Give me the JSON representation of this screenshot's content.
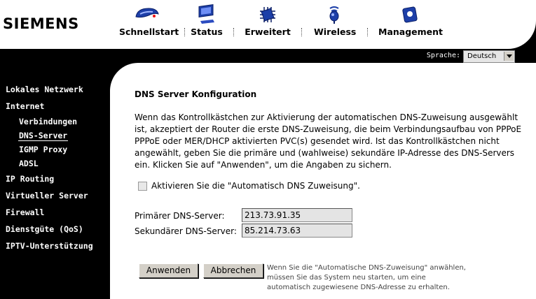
{
  "header": {
    "logo": "SIEMENS",
    "nav": [
      {
        "label": "Schnellstart",
        "icon": "setup-wand-icon"
      },
      {
        "label": "Status",
        "icon": "monitor-icon"
      },
      {
        "label": "Erweitert",
        "icon": "chip-icon"
      },
      {
        "label": "Wireless",
        "icon": "antenna-icon"
      },
      {
        "label": "Management",
        "icon": "card-icon"
      }
    ]
  },
  "language": {
    "label": "Sprache:",
    "selected": "Deutsch"
  },
  "sidebar": {
    "items": [
      {
        "label": "Lokales Netzwerk"
      },
      {
        "label": "Internet"
      },
      {
        "label": "Verbindungen"
      },
      {
        "label": "DNS-Server",
        "active": true
      },
      {
        "label": "IGMP Proxy"
      },
      {
        "label": "ADSL"
      },
      {
        "label": "IP Routing"
      },
      {
        "label": "Virtueller Server"
      },
      {
        "label": "Firewall"
      },
      {
        "label": "Dienstgüte (QoS)"
      },
      {
        "label": "IPTV-Unterstützung"
      }
    ]
  },
  "main": {
    "title": "DNS Server Konfiguration",
    "description": "Wenn das Kontrollkästchen zur Aktivierung der automatischen DNS-Zuweisung ausgewählt\nist, akzeptiert der Router die erste DNS-Zuweisung, die beim Verbindungsaufbau von PPPoE\nPPPoE oder MER/DHCP aktivierten PVC(s) gesendet wird. Ist das Kontrollkästchen nicht\nangewählt, geben Sie die primäre und (wahlweise) sekundäre IP-Adresse des DNS-Servers\nein. Klicken Sie auf \"Anwenden\", um die Angaben zu sichern.",
    "checkbox_label": "Aktivieren Sie die \"Automatisch DNS Zuweisung\".",
    "checkbox_checked": false,
    "primary_label": "Primärer DNS-Server:",
    "primary_value": "213.73.91.35",
    "secondary_label": "Sekundärer DNS-Server:",
    "secondary_value": "85.214.73.63",
    "apply_label": "Anwenden",
    "cancel_label": "Abbrechen",
    "hint": "Wenn Sie die \"Automatische DNS-Zuweisung\" anwählen,\nmüssen Sie das System neu starten, um eine\nautomatisch zugewiesene DNS-Adresse zu erhalten."
  },
  "colors": {
    "background": "#000000",
    "panel": "#ffffff",
    "nav_icon_blue": "#1d3fa8"
  }
}
